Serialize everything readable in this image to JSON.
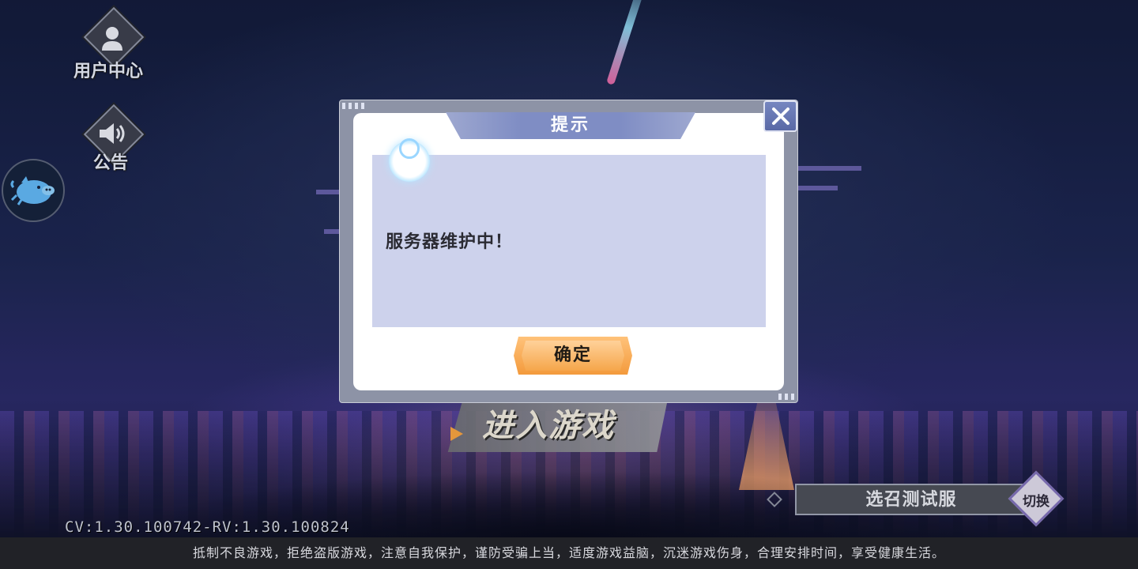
{
  "left_menu": {
    "user_center_label": "用户中心",
    "announcement_label": "公告"
  },
  "enter_game": {
    "label": "进入游戏"
  },
  "server": {
    "name": "选召测试服",
    "switch_label": "切换"
  },
  "version_text": "CV:1.30.100742-RV:1.30.100824",
  "footer_text": "抵制不良游戏，拒绝盗版游戏，注意自我保护，谨防受骗上当，适度游戏益脑，沉迷游戏伤身，合理安排时间，享受健康生活。",
  "dialog": {
    "title": "提示",
    "message": "服务器维护中！",
    "confirm_label": "确定"
  },
  "colors": {
    "dialog_title_bar": "#7f8dc4",
    "dialog_content_bg": "#cdd2ec",
    "confirm_button": "#f39a3c",
    "close_button": "#5a69a6"
  },
  "icons": [
    "user-icon",
    "speaker-icon",
    "pig-icon",
    "close-icon",
    "play-arrow-icon"
  ]
}
